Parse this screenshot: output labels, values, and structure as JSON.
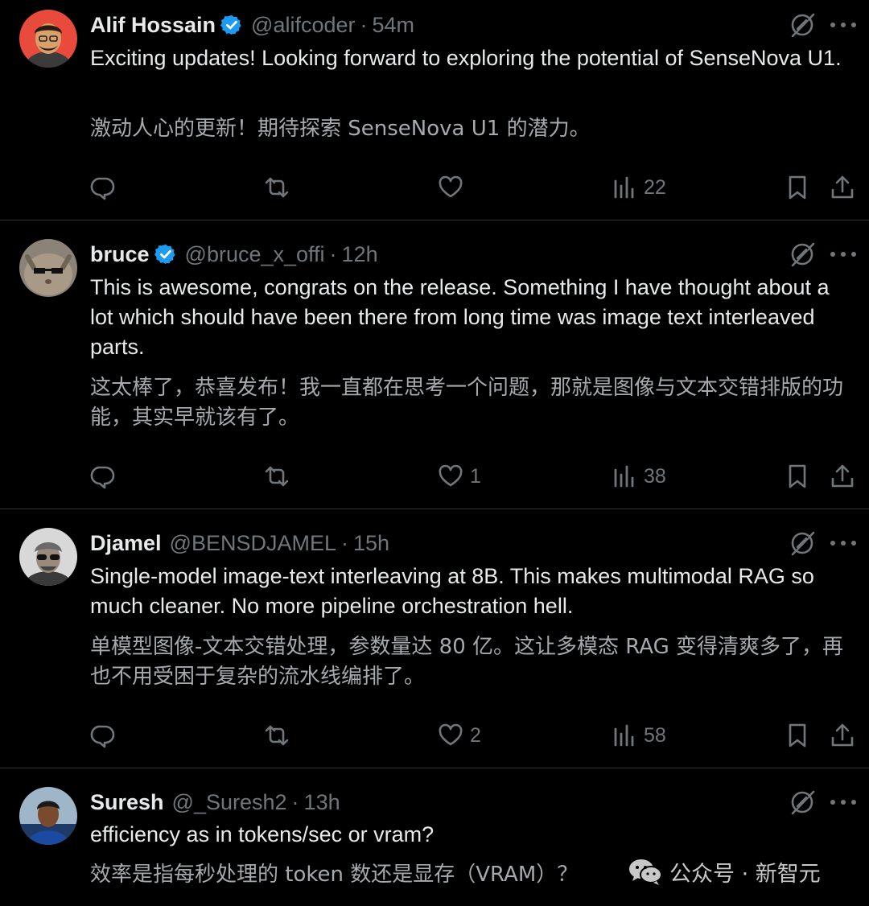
{
  "tweets": [
    {
      "name": "Alif Hossain",
      "handle": "@alifcoder",
      "time": "54m",
      "text_en": "Exciting updates! Looking forward to exploring the potential of SenseNova U1.",
      "text_zh": "激动人心的更新！期待探索 SenseNova U1 的潜力。",
      "likes": "",
      "views": "22"
    },
    {
      "name": "bruce",
      "handle": "@bruce_x_offi",
      "time": "12h",
      "text_en": "This is awesome, congrats on the release. Something I have thought about a lot which should have been there from long time was image text interleaved parts.",
      "text_zh": "这太棒了，恭喜发布！我一直都在思考一个问题，那就是图像与文本交错排版的功能，其实早就该有了。",
      "likes": "1",
      "views": "38"
    },
    {
      "name": "Djamel",
      "handle": "@BENSDJAMEL",
      "time": "15h",
      "text_en": "Single-model image-text interleaving at 8B. This makes multimodal RAG so much cleaner. No more pipeline orchestration hell.",
      "text_zh": "单模型图像-文本交错处理，参数量达 80 亿。这让多模态 RAG 变得清爽多了，再也不用受困于复杂的流水线编排了。",
      "likes": "2",
      "views": "58"
    },
    {
      "name": "Suresh",
      "handle": "@_Suresh2",
      "time": "13h",
      "text_en": "efficiency as in tokens/sec or vram?",
      "text_zh": "效率是指每秒处理的 token 数还是显存（VRAM）？"
    }
  ],
  "separator": "·",
  "watermark": "公众号 · 新智元",
  "icons": [
    "verified-badge-icon",
    "grok-icon",
    "more-icon",
    "reply-icon",
    "retweet-icon",
    "like-icon",
    "views-icon",
    "bookmark-icon",
    "share-icon",
    "wechat-icon"
  ],
  "colors": {
    "background": "#000000",
    "text": "#e7e9ea",
    "muted": "#71767b",
    "verified": "#1d9bf0",
    "divider": "#2f3336"
  }
}
